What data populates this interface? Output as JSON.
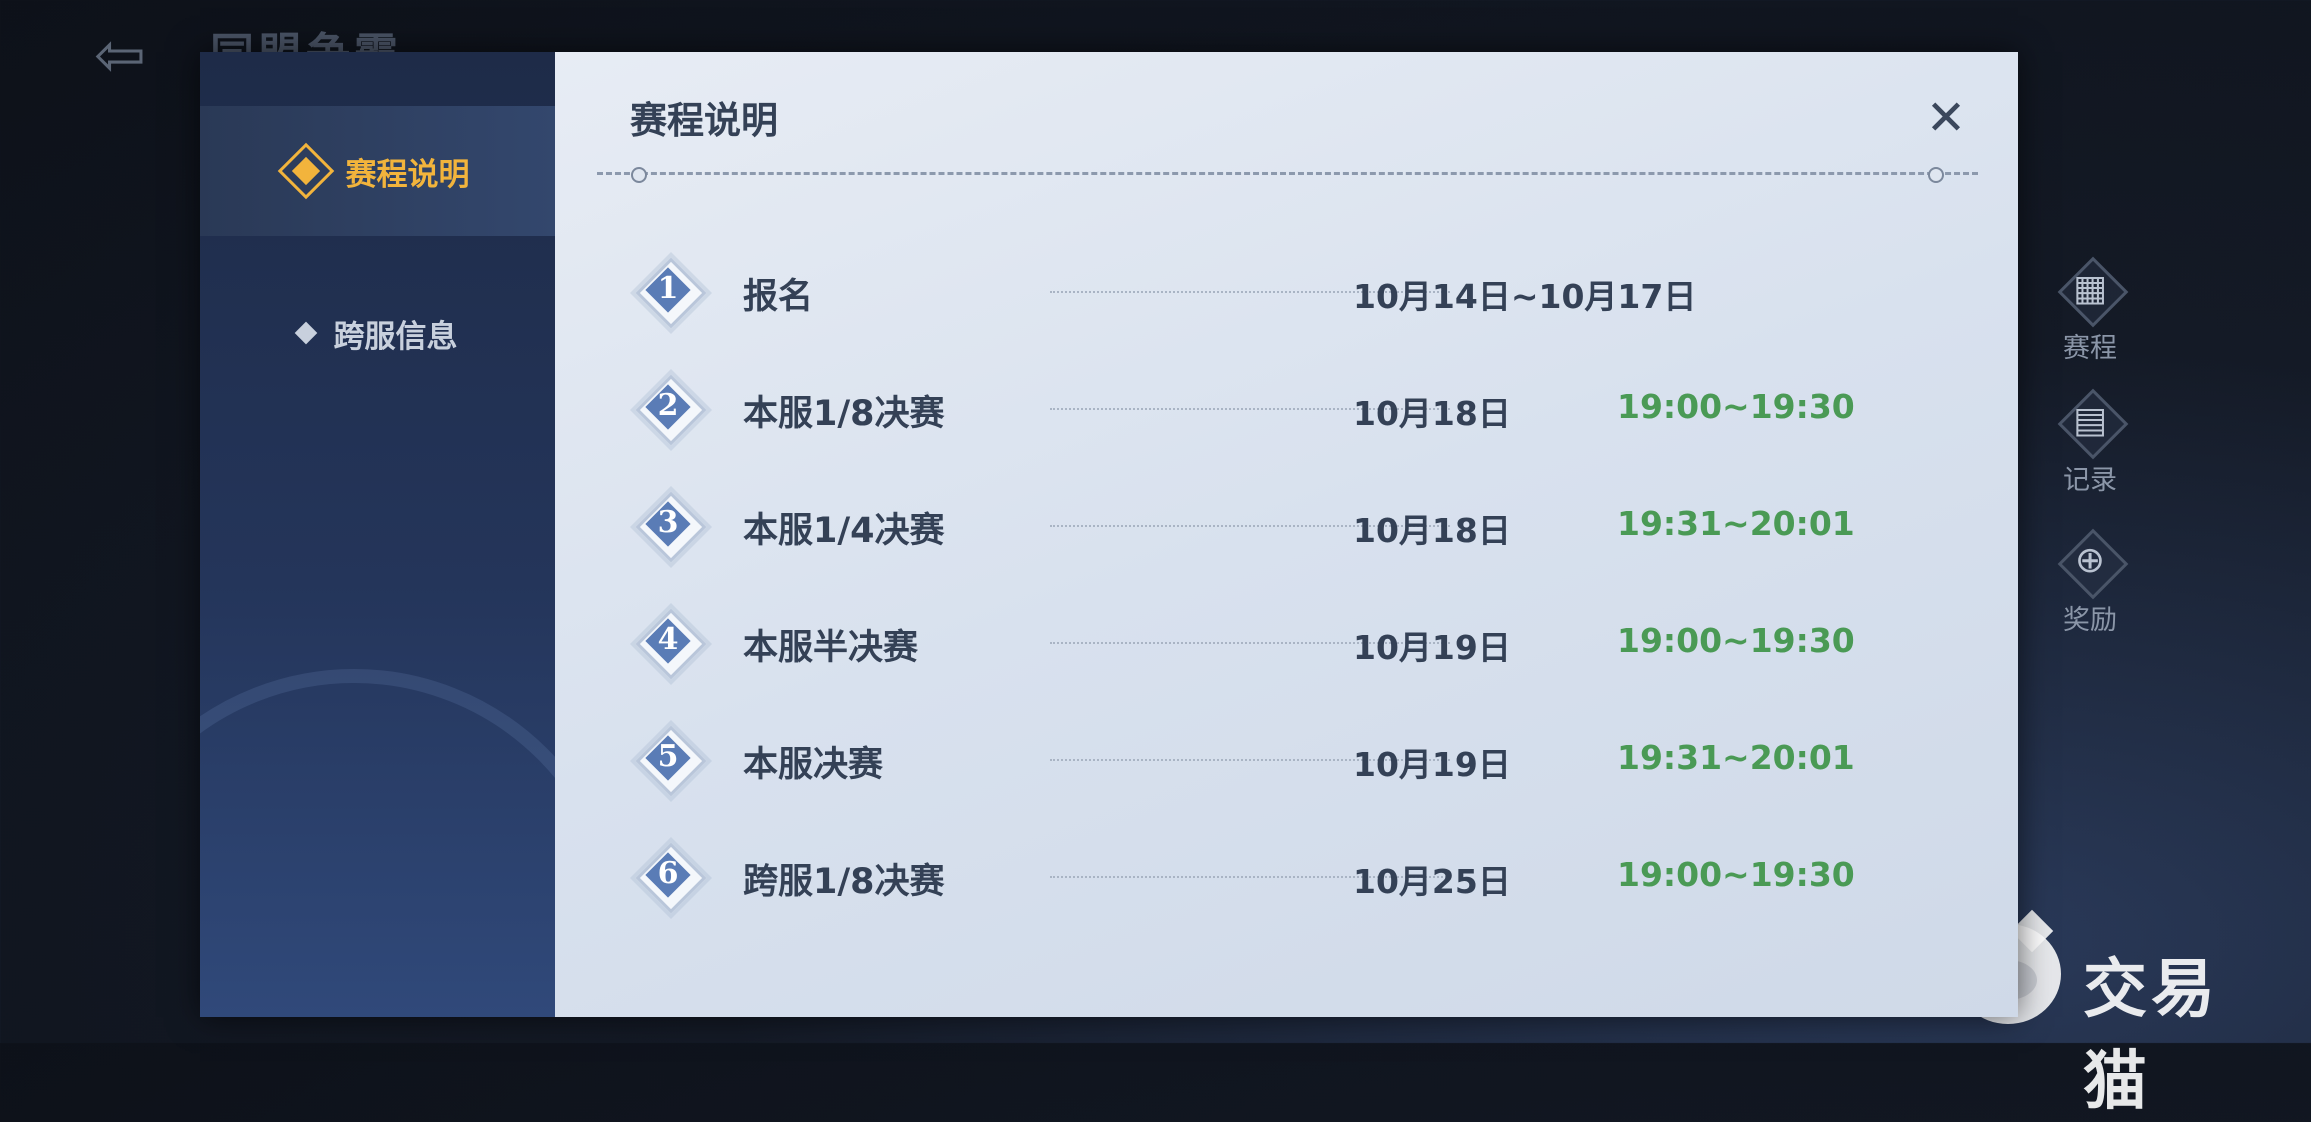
{
  "background": {
    "title": "同盟争霸",
    "side_buttons": [
      {
        "label": "赛程",
        "icon": "calendar-icon"
      },
      {
        "label": "记录",
        "icon": "clipboard-icon"
      },
      {
        "label": "奖励",
        "icon": "reward-icon"
      }
    ]
  },
  "sidebar": {
    "tabs": [
      {
        "label": "赛程说明"
      },
      {
        "label": "跨服信息"
      }
    ]
  },
  "main": {
    "title": "赛程说明",
    "schedule": [
      {
        "num": "1",
        "name": "报名",
        "date": "10月14日~10月17日",
        "time": ""
      },
      {
        "num": "2",
        "name": "本服1/8决赛",
        "date": "10月18日",
        "time": "19:00~19:30"
      },
      {
        "num": "3",
        "name": "本服1/4决赛",
        "date": "10月18日",
        "time": "19:31~20:01"
      },
      {
        "num": "4",
        "name": "本服半决赛",
        "date": "10月19日",
        "time": "19:00~19:30"
      },
      {
        "num": "5",
        "name": "本服决赛",
        "date": "10月19日",
        "time": "19:31~20:01"
      },
      {
        "num": "6",
        "name": "跨服1/8决赛",
        "date": "10月25日",
        "time": "19:00~19:30"
      }
    ]
  },
  "watermark": {
    "text": "交易猫"
  },
  "colors": {
    "accent": "#f2b43c",
    "time": "#4a9a55",
    "text": "#344156",
    "badge": "#5a7cb6"
  }
}
